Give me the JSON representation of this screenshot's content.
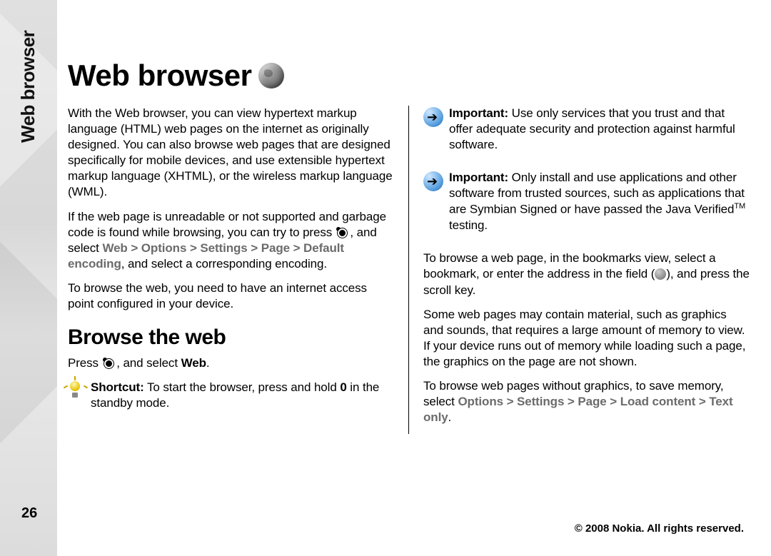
{
  "running_head": "Web browser",
  "page_number": "26",
  "copyright": "© 2008 Nokia. All rights reserved.",
  "title": "Web browser",
  "left": {
    "intro": "With the Web browser, you can view hypertext markup language (HTML) web pages on the internet as originally designed. You can also browse web pages that are designed specifically for mobile devices, and use extensible hypertext markup language (XHTML), or the wireless markup language (WML).",
    "unreadable_a": "If the web page is unreadable or not supported and garbage code is found while browsing, you can try to press ",
    "unreadable_b": " , and select ",
    "menu_web": "Web",
    "menu_options": "Options",
    "menu_settings": "Settings",
    "menu_page": "Page",
    "menu_default_encoding": "Default encoding",
    "unreadable_c": ", and select a corresponding encoding.",
    "ap": "To browse the web, you need to have an internet access point configured in your device.",
    "subhead": "Browse the web",
    "press_a": "Press ",
    "press_b": " , and select ",
    "press_web": "Web",
    "press_c": ".",
    "shortcut_label": "Shortcut:",
    "shortcut_a": " To start the browser, press and hold ",
    "shortcut_key": "0",
    "shortcut_b": " in the standby mode."
  },
  "right": {
    "note1_label": "Important:",
    "note1_text": "  Use only services that you trust and that offer adequate security and protection against harmful software.",
    "note2_label": "Important:",
    "note2_text": "  Only install and use applications and other software from trusted sources, such as applications that are Symbian Signed or have passed the Java Verified",
    "note2_tm": "TM",
    "note2_tail": " testing.",
    "browse_a": "To browse a web page, in the bookmarks view, select a bookmark, or enter the address in the field (",
    "browse_b": "), and press the scroll key.",
    "memory": "Some web pages may contain material, such as graphics and sounds, that requires a large amount of memory to view. If your device runs out of memory while loading such a page, the graphics on the page are not shown.",
    "nographics_a": "To browse web pages without graphics, to save memory, select ",
    "menu_options": "Options",
    "menu_settings": "Settings",
    "menu_page": "Page",
    "menu_load_content": "Load content",
    "menu_text_only": "Text only",
    "nographics_b": "."
  },
  "sep": ">"
}
